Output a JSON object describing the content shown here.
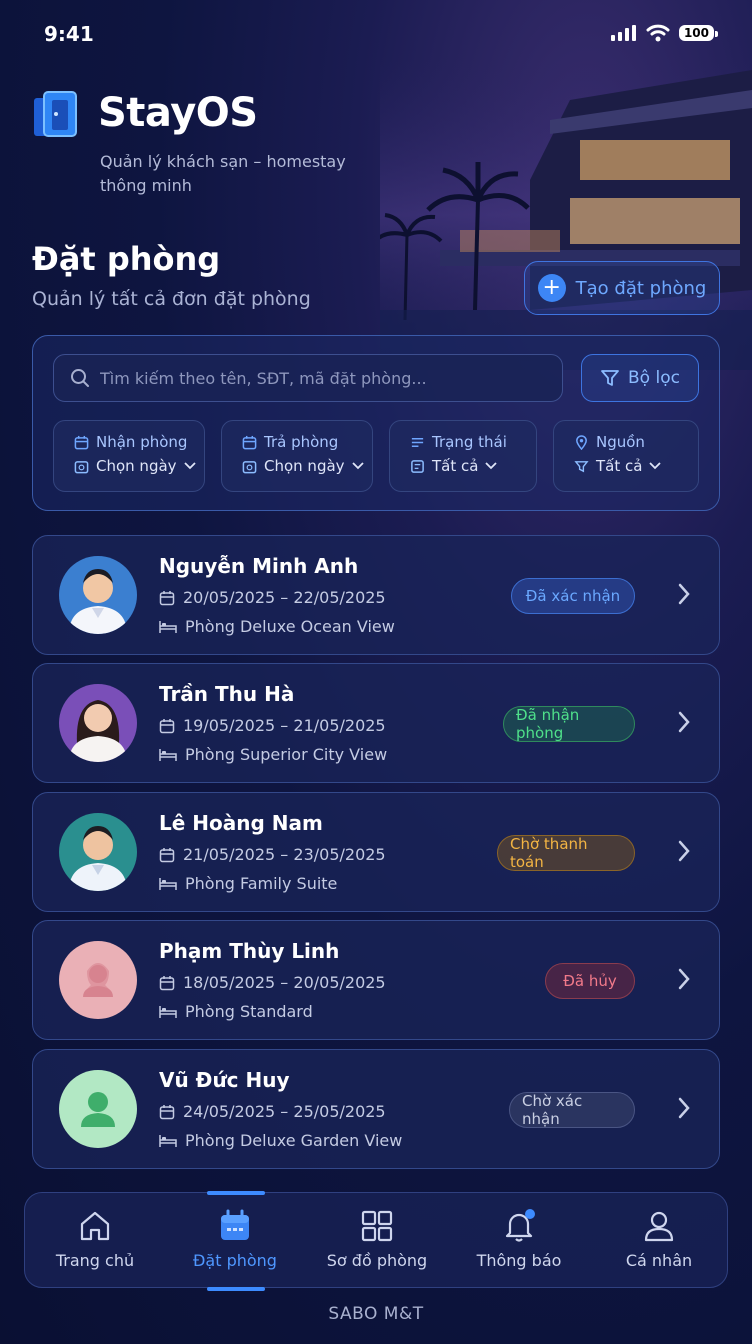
{
  "status_bar": {
    "time": "9:41",
    "battery": "100"
  },
  "app": {
    "name": "StayOS",
    "tagline": "Quản lý khách sạn – homestay thông minh"
  },
  "page": {
    "title": "Đặt phòng",
    "subtitle": "Quản lý tất cả đơn đặt phòng",
    "create_button": "Tạo đặt phòng"
  },
  "search": {
    "placeholder": "Tìm kiếm theo tên, SĐT, mã đặt phòng...",
    "value": ""
  },
  "filter_button": "Bộ lọc",
  "filters": [
    {
      "label": "Nhận phòng",
      "value": "Chọn ngày"
    },
    {
      "label": "Trả phòng",
      "value": "Chọn ngày"
    },
    {
      "label": "Trạng thái",
      "value": "Tất cả"
    },
    {
      "label": "Nguồn",
      "value": "Tất cả"
    }
  ],
  "bookings": [
    {
      "name": "Nguyễn Minh Anh",
      "dates": "20/05/2025 – 22/05/2025",
      "room": "Phòng Deluxe Ocean View",
      "status": "Đã xác nhận",
      "status_color": "#6aa8ff"
    },
    {
      "name": "Trần Thu Hà",
      "dates": "19/05/2025 – 21/05/2025",
      "room": "Phòng Superior City View",
      "status": "Đã nhận phòng",
      "status_color": "#4fe08a"
    },
    {
      "name": "Lê Hoàng Nam",
      "dates": "21/05/2025 – 23/05/2025",
      "room": "Phòng Family Suite",
      "status": "Chờ thanh toán",
      "status_color": "#f3b443"
    },
    {
      "name": "Phạm Thùy Linh",
      "dates": "18/05/2025 – 20/05/2025",
      "room": "Phòng Standard",
      "status": "Đã hủy",
      "status_color": "#f27a8a"
    },
    {
      "name": "Vũ Đức Huy",
      "dates": "24/05/2025 – 25/05/2025",
      "room": "Phòng Deluxe Garden View",
      "status": "Chờ xác nhận",
      "status_color": "#c9cfe3"
    }
  ],
  "tabs": [
    {
      "label": "Trang chủ",
      "icon": "home-icon"
    },
    {
      "label": "Đặt phòng",
      "icon": "calendar-icon",
      "active": true
    },
    {
      "label": "Sơ đồ phòng",
      "icon": "grid-icon"
    },
    {
      "label": "Thông báo",
      "icon": "bell-icon"
    },
    {
      "label": "Cá nhân",
      "icon": "user-icon"
    }
  ],
  "footer": "SABO M&T",
  "colors": {
    "accent": "#3d86f5",
    "background": "#0b1235"
  }
}
